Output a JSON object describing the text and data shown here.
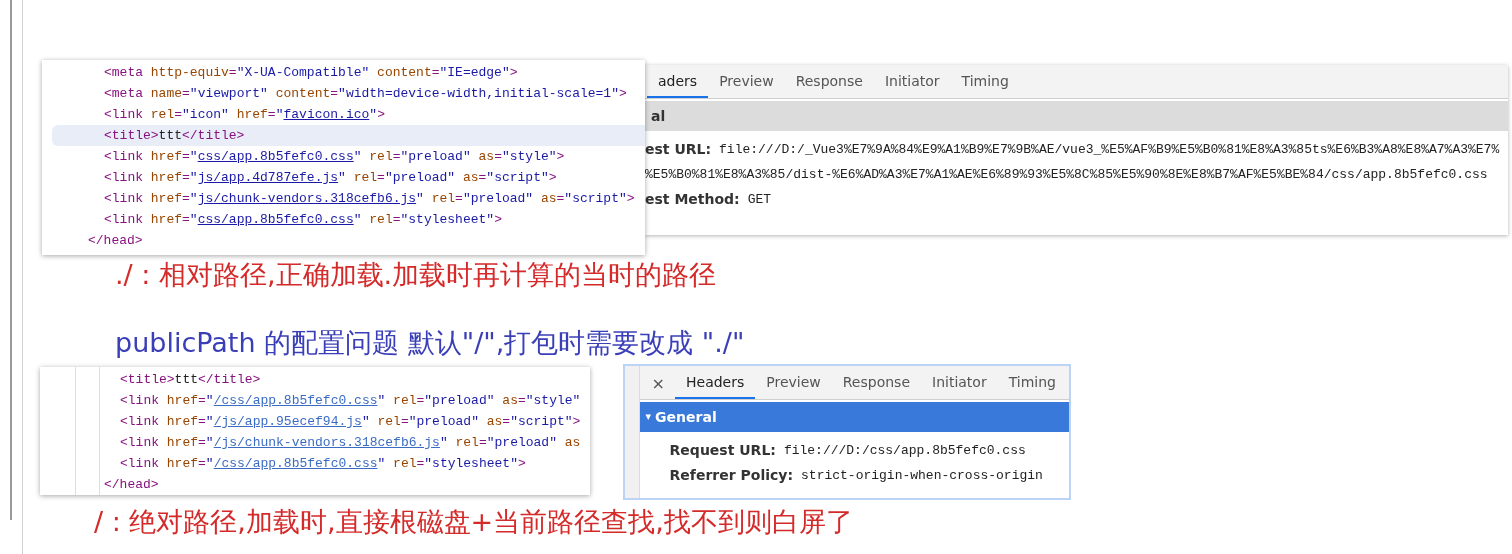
{
  "code_panels": [
    {
      "lines": [
        {
          "kind": "inner",
          "selected": false,
          "tokens": [
            {
              "kind": "tag",
              "text": "<meta "
            },
            {
              "kind": "attr",
              "text": "http-equiv"
            },
            {
              "kind": "tag",
              "text": "="
            },
            {
              "kind": "value",
              "text": "\"X-UA-Compatible\" "
            },
            {
              "kind": "attr",
              "text": "content"
            },
            {
              "kind": "tag",
              "text": "="
            },
            {
              "kind": "value",
              "text": "\"IE=edge\""
            },
            {
              "kind": "tag",
              "text": ">"
            }
          ]
        },
        {
          "kind": "inner",
          "selected": false,
          "tokens": [
            {
              "kind": "tag",
              "text": "<meta "
            },
            {
              "kind": "attr",
              "text": "name"
            },
            {
              "kind": "tag",
              "text": "="
            },
            {
              "kind": "value",
              "text": "\"viewport\" "
            },
            {
              "kind": "attr",
              "text": "content"
            },
            {
              "kind": "tag",
              "text": "="
            },
            {
              "kind": "value",
              "text": "\"width=device-width,initial-scale=1\""
            },
            {
              "kind": "tag",
              "text": ">"
            }
          ]
        },
        {
          "kind": "inner",
          "selected": false,
          "tokens": [
            {
              "kind": "tag",
              "text": "<link "
            },
            {
              "kind": "attr",
              "text": "rel"
            },
            {
              "kind": "tag",
              "text": "="
            },
            {
              "kind": "value",
              "text": "\"icon\" "
            },
            {
              "kind": "attr",
              "text": "href"
            },
            {
              "kind": "tag",
              "text": "="
            },
            {
              "kind": "value",
              "text": "\""
            },
            {
              "kind": "link",
              "text": "favicon.ico"
            },
            {
              "kind": "value",
              "text": "\""
            },
            {
              "kind": "tag",
              "text": ">"
            }
          ]
        },
        {
          "kind": "inner",
          "selected": true,
          "tokens": [
            {
              "kind": "tag",
              "text": "<title>"
            },
            {
              "kind": "text",
              "text": "ttt"
            },
            {
              "kind": "tag",
              "text": "</title>"
            }
          ]
        },
        {
          "kind": "inner",
          "selected": false,
          "tokens": [
            {
              "kind": "tag",
              "text": "<link "
            },
            {
              "kind": "attr",
              "text": "href"
            },
            {
              "kind": "tag",
              "text": "="
            },
            {
              "kind": "value",
              "text": "\""
            },
            {
              "kind": "link",
              "text": "css/app.8b5fefc0.css"
            },
            {
              "kind": "value",
              "text": "\" "
            },
            {
              "kind": "attr",
              "text": "rel"
            },
            {
              "kind": "tag",
              "text": "="
            },
            {
              "kind": "value",
              "text": "\"preload\" "
            },
            {
              "kind": "attr",
              "text": "as"
            },
            {
              "kind": "tag",
              "text": "="
            },
            {
              "kind": "value",
              "text": "\"style\""
            },
            {
              "kind": "tag",
              "text": ">"
            }
          ]
        },
        {
          "kind": "inner",
          "selected": false,
          "tokens": [
            {
              "kind": "tag",
              "text": "<link "
            },
            {
              "kind": "attr",
              "text": "href"
            },
            {
              "kind": "tag",
              "text": "="
            },
            {
              "kind": "value",
              "text": "\""
            },
            {
              "kind": "link",
              "text": "js/app.4d787efe.js"
            },
            {
              "kind": "value",
              "text": "\" "
            },
            {
              "kind": "attr",
              "text": "rel"
            },
            {
              "kind": "tag",
              "text": "="
            },
            {
              "kind": "value",
              "text": "\"preload\" "
            },
            {
              "kind": "attr",
              "text": "as"
            },
            {
              "kind": "tag",
              "text": "="
            },
            {
              "kind": "value",
              "text": "\"script\""
            },
            {
              "kind": "tag",
              "text": ">"
            }
          ]
        },
        {
          "kind": "inner",
          "selected": false,
          "tokens": [
            {
              "kind": "tag",
              "text": "<link "
            },
            {
              "kind": "attr",
              "text": "href"
            },
            {
              "kind": "tag",
              "text": "="
            },
            {
              "kind": "value",
              "text": "\""
            },
            {
              "kind": "link",
              "text": "js/chunk-vendors.318cefb6.js"
            },
            {
              "kind": "value",
              "text": "\" "
            },
            {
              "kind": "attr",
              "text": "rel"
            },
            {
              "kind": "tag",
              "text": "="
            },
            {
              "kind": "value",
              "text": "\"preload\" "
            },
            {
              "kind": "attr",
              "text": "as"
            },
            {
              "kind": "tag",
              "text": "="
            },
            {
              "kind": "value",
              "text": "\"script\""
            },
            {
              "kind": "tag",
              "text": ">"
            }
          ]
        },
        {
          "kind": "inner",
          "selected": false,
          "tokens": [
            {
              "kind": "tag",
              "text": "<link "
            },
            {
              "kind": "attr",
              "text": "href"
            },
            {
              "kind": "tag",
              "text": "="
            },
            {
              "kind": "value",
              "text": "\""
            },
            {
              "kind": "link",
              "text": "css/app.8b5fefc0.css"
            },
            {
              "kind": "value",
              "text": "\" "
            },
            {
              "kind": "attr",
              "text": "rel"
            },
            {
              "kind": "tag",
              "text": "="
            },
            {
              "kind": "value",
              "text": "\"stylesheet\""
            },
            {
              "kind": "tag",
              "text": ">"
            }
          ]
        },
        {
          "kind": "closing",
          "selected": false,
          "tokens": [
            {
              "kind": "tag",
              "text": "</head>"
            }
          ]
        }
      ]
    },
    {
      "lines": [
        {
          "kind": "inner",
          "selected": false,
          "tokens": [
            {
              "kind": "tag",
              "text": "<title>"
            },
            {
              "kind": "text",
              "text": "ttt"
            },
            {
              "kind": "tag",
              "text": "</title>"
            }
          ]
        },
        {
          "kind": "inner",
          "selected": false,
          "tokens": [
            {
              "kind": "tag",
              "text": "<link "
            },
            {
              "kind": "attr",
              "text": "href"
            },
            {
              "kind": "tag",
              "text": "="
            },
            {
              "kind": "value",
              "text": "\""
            },
            {
              "kind": "link",
              "text": "/css/app.8b5fefc0.css"
            },
            {
              "kind": "value",
              "text": "\" "
            },
            {
              "kind": "attr",
              "text": "rel"
            },
            {
              "kind": "tag",
              "text": "="
            },
            {
              "kind": "value",
              "text": "\"preload\" "
            },
            {
              "kind": "attr",
              "text": "as"
            },
            {
              "kind": "tag",
              "text": "="
            },
            {
              "kind": "value",
              "text": "\"style\""
            }
          ]
        },
        {
          "kind": "inner",
          "selected": false,
          "tokens": [
            {
              "kind": "tag",
              "text": "<link "
            },
            {
              "kind": "attr",
              "text": "href"
            },
            {
              "kind": "tag",
              "text": "="
            },
            {
              "kind": "value",
              "text": "\""
            },
            {
              "kind": "link",
              "text": "/js/app.95ecef94.js"
            },
            {
              "kind": "value",
              "text": "\" "
            },
            {
              "kind": "attr",
              "text": "rel"
            },
            {
              "kind": "tag",
              "text": "="
            },
            {
              "kind": "value",
              "text": "\"preload\" "
            },
            {
              "kind": "attr",
              "text": "as"
            },
            {
              "kind": "tag",
              "text": "="
            },
            {
              "kind": "value",
              "text": "\"script\""
            },
            {
              "kind": "tag",
              "text": ">"
            }
          ]
        },
        {
          "kind": "inner",
          "selected": false,
          "tokens": [
            {
              "kind": "tag",
              "text": "<link "
            },
            {
              "kind": "attr",
              "text": "href"
            },
            {
              "kind": "tag",
              "text": "="
            },
            {
              "kind": "value",
              "text": "\""
            },
            {
              "kind": "link",
              "text": "/js/chunk-vendors.318cefb6.js"
            },
            {
              "kind": "value",
              "text": "\" "
            },
            {
              "kind": "attr",
              "text": "rel"
            },
            {
              "kind": "tag",
              "text": "="
            },
            {
              "kind": "value",
              "text": "\"preload\" "
            },
            {
              "kind": "attr",
              "text": "as"
            }
          ]
        },
        {
          "kind": "inner",
          "selected": false,
          "tokens": [
            {
              "kind": "tag",
              "text": "<link "
            },
            {
              "kind": "attr",
              "text": "href"
            },
            {
              "kind": "tag",
              "text": "="
            },
            {
              "kind": "value",
              "text": "\""
            },
            {
              "kind": "link",
              "text": "/css/app.8b5fefc0.css"
            },
            {
              "kind": "value",
              "text": "\" "
            },
            {
              "kind": "attr",
              "text": "rel"
            },
            {
              "kind": "tag",
              "text": "="
            },
            {
              "kind": "value",
              "text": "\"stylesheet\""
            },
            {
              "kind": "tag",
              "text": ">"
            }
          ]
        },
        {
          "kind": "closing",
          "selected": false,
          "tokens": [
            {
              "kind": "tag",
              "text": "</head>"
            }
          ]
        }
      ]
    }
  ],
  "network_panels": [
    {
      "tabs": [
        {
          "label": "aders",
          "selected": true
        },
        {
          "label": "Preview",
          "selected": false
        },
        {
          "label": "Response",
          "selected": false
        },
        {
          "label": "Initiator",
          "selected": false
        },
        {
          "label": "Timing",
          "selected": false
        }
      ],
      "section": {
        "title": "al",
        "highlighted": false
      },
      "rows": [
        {
          "label": "est URL:",
          "value": "file:///D:/_Vue3%E7%9A%84%E9%A1%B9%E7%9B%AE/vue3_%E5%AF%B9%E5%B0%81%E8%A3%85ts%E6%B3%A8%E8%A7%A3%E7%"
        },
        {
          "value": "%E5%B0%81%E8%A3%85/dist-%E6%AD%A3%E7%A1%AE%E6%89%93%E5%8C%85%E5%90%8E%E8%B7%AF%E5%BE%84/css/app.8b5fefc0.css"
        },
        {
          "label": "est Method:",
          "value": "GET"
        }
      ]
    },
    {
      "close": "×",
      "tabs": [
        {
          "label": "Headers",
          "selected": true
        },
        {
          "label": "Preview",
          "selected": false
        },
        {
          "label": "Response",
          "selected": false
        },
        {
          "label": "Initiator",
          "selected": false
        },
        {
          "label": "Timing",
          "selected": false
        }
      ],
      "section": {
        "title": "General",
        "arrow": "▾",
        "highlighted": true
      },
      "rows": [
        {
          "label": "Request URL:",
          "value": "file:///D:/css/app.8b5fefc0.css"
        },
        {
          "label": "Referrer Policy:",
          "value": "strict-origin-when-cross-origin"
        }
      ]
    }
  ],
  "notes": [
    {
      "kind": "red",
      "text": "./ : 相对路径,正确加载.加载时再计算的当时的路径"
    },
    {
      "kind": "blue",
      "text": "publicPath 的配置问题 默认\"/\",打包时需要改成 \"./\""
    },
    {
      "kind": "red",
      "text": "/ : 绝对路径,加载时,直接根磁盘+当前路径查找,找不到则白屏了"
    }
  ]
}
